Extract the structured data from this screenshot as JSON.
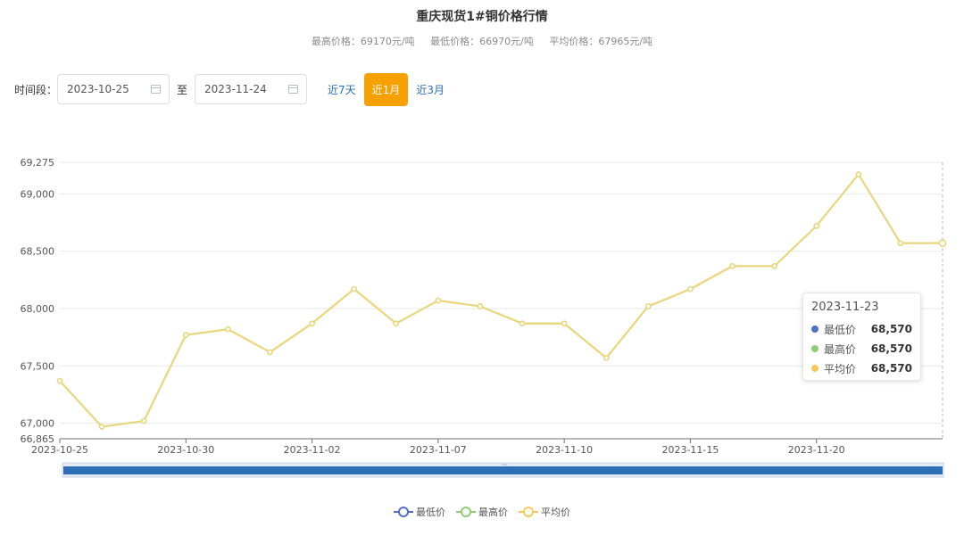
{
  "page": {
    "title": "重庆现货1#铜价格行情",
    "stats": {
      "high": "最高价格：69170元/吨",
      "low": "最低价格：66970元/吨",
      "avg": "平均价格：67965元/吨"
    }
  },
  "filter": {
    "label": "时间段：",
    "start_date": "2023-10-25",
    "separator": "至",
    "end_date": "2023-11-24",
    "quick": [
      "近7天",
      "近1月",
      "近3月"
    ],
    "active_quick": "近1月"
  },
  "tooltip": {
    "date": "2023-11-23",
    "rows": [
      {
        "name": "最低价",
        "value": "68,570",
        "color": "#5470c6"
      },
      {
        "name": "最高价",
        "value": "68,570",
        "color": "#91cc75"
      },
      {
        "name": "平均价",
        "value": "68,570",
        "color": "#fac858"
      }
    ]
  },
  "legend": [
    {
      "name": "最低价",
      "color": "#5470c6"
    },
    {
      "name": "最高价",
      "color": "#91cc75"
    },
    {
      "name": "平均价",
      "color": "#fac858"
    }
  ],
  "chart_data": {
    "type": "line",
    "title": "重庆现货1#铜价格行情",
    "x": [
      "2023-10-25",
      "2023-10-26",
      "2023-10-27",
      "2023-10-30",
      "2023-10-31",
      "2023-11-01",
      "2023-11-02",
      "2023-11-03",
      "2023-11-06",
      "2023-11-07",
      "2023-11-08",
      "2023-11-09",
      "2023-11-10",
      "2023-11-13",
      "2023-11-14",
      "2023-11-15",
      "2023-11-16",
      "2023-11-17",
      "2023-11-20",
      "2023-11-21",
      "2023-11-22",
      "2023-11-23"
    ],
    "x_tick_labels": [
      "2023-10-25",
      "2023-10-30",
      "2023-11-02",
      "2023-11-07",
      "2023-11-10",
      "2023-11-15",
      "2023-11-20"
    ],
    "series": [
      {
        "name": "最低价",
        "values": [
          67370,
          66970,
          67020,
          67770,
          67820,
          67620,
          67870,
          68170,
          67870,
          68070,
          68020,
          67870,
          67870,
          67570,
          68020,
          68170,
          68370,
          68370,
          68720,
          69170,
          68570,
          68570
        ]
      },
      {
        "name": "最高价",
        "values": [
          67370,
          66970,
          67020,
          67770,
          67820,
          67620,
          67870,
          68170,
          67870,
          68070,
          68020,
          67870,
          67870,
          67570,
          68020,
          68170,
          68370,
          68370,
          68720,
          69170,
          68570,
          68570
        ]
      },
      {
        "name": "平均价",
        "values": [
          67370,
          66970,
          67020,
          67770,
          67820,
          67620,
          67870,
          68170,
          67870,
          68070,
          68020,
          67870,
          67870,
          67570,
          68020,
          68170,
          68370,
          68370,
          68720,
          69170,
          68570,
          68570
        ]
      }
    ],
    "y_ticks": [
      "66,865",
      "67,000",
      "67,500",
      "68,000",
      "68,500",
      "69,000",
      "69,275"
    ],
    "ylim": [
      66865,
      69275
    ],
    "grid": true,
    "legend_position": "bottom-center",
    "line_color": "#e8d77e"
  }
}
